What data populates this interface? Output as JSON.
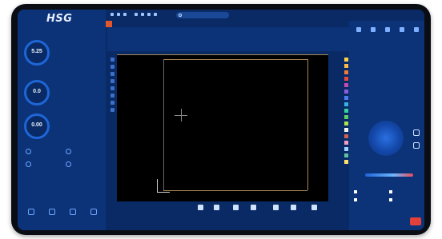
{
  "app": {
    "logo": "HSG"
  },
  "topbar": {
    "search_placeholder": "",
    "right_title": "",
    "right_subtitle": ""
  },
  "tabs": [
    "",
    "",
    ""
  ],
  "gauges": [
    {
      "value": "5.25",
      "unit": ""
    },
    {
      "value": "0.0",
      "unit": ""
    },
    {
      "value": "0.00",
      "unit": ""
    }
  ],
  "canvas": {
    "lines": [
      "",
      "",
      ""
    ]
  },
  "bottom_toolbar": {
    "log_lines": [
      "",
      ""
    ]
  },
  "right_panel": {
    "checks": [
      "",
      "",
      "",
      ""
    ]
  },
  "colors": {
    "accent": "#e2562c",
    "panel": "#0c3278",
    "background": "#0a2a66"
  },
  "palette": [
    "#ffd04a",
    "#ffb84a",
    "#f27a3a",
    "#e84a3c",
    "#c34ab0",
    "#8a5ee0",
    "#4a7ef0",
    "#3ab0e0",
    "#3ad0a0",
    "#5ad060",
    "#b0e050",
    "#f0f0f0",
    "#d06050",
    "#f0a0c0",
    "#a0d0ff",
    "#60c0a0",
    "#ffe070"
  ]
}
